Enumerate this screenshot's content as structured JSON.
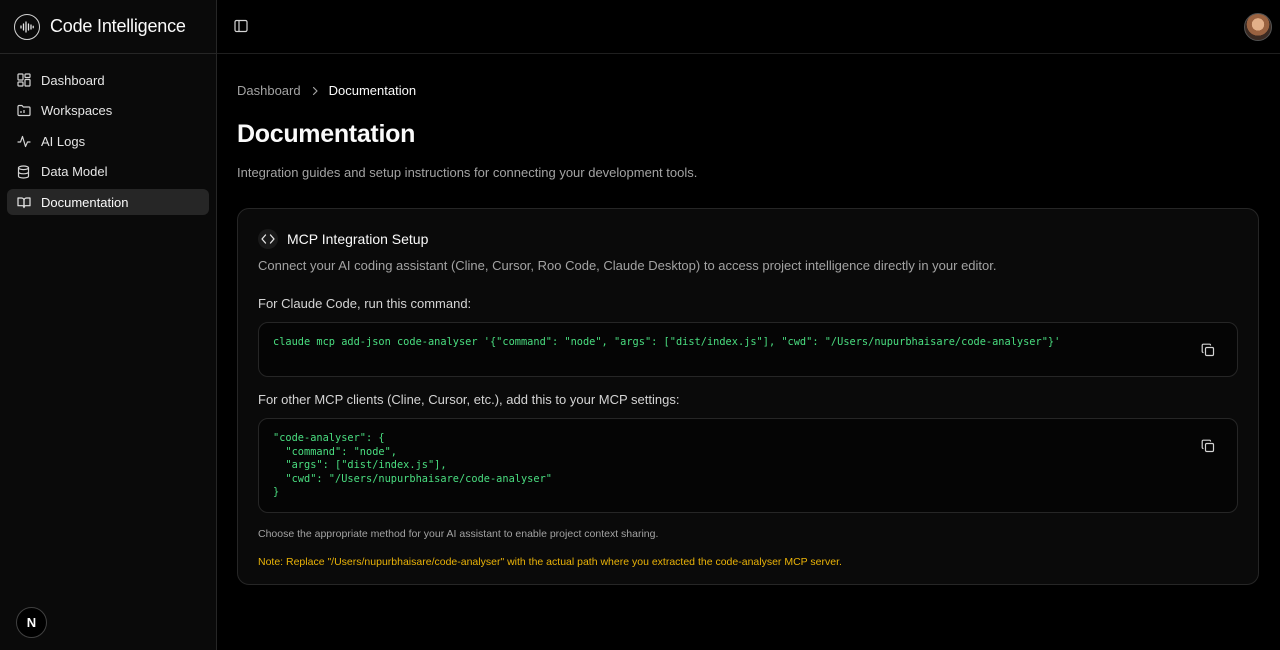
{
  "app": {
    "title": "Code Intelligence",
    "logo_icon": "waveform-logo-icon",
    "badge_letter": "N"
  },
  "sidebar": {
    "items": [
      {
        "label": "Dashboard",
        "icon": "dashboard-grid-icon",
        "active": false
      },
      {
        "label": "Workspaces",
        "icon": "folder-icon",
        "active": false
      },
      {
        "label": "AI Logs",
        "icon": "activity-icon",
        "active": false
      },
      {
        "label": "Data Model",
        "icon": "database-icon",
        "active": false
      },
      {
        "label": "Documentation",
        "icon": "book-icon",
        "active": true
      }
    ]
  },
  "breadcrumb": {
    "items": [
      "Dashboard",
      "Documentation"
    ]
  },
  "page": {
    "title": "Documentation",
    "subtitle": "Integration guides and setup instructions for connecting your development tools."
  },
  "card": {
    "title": "MCP Integration Setup",
    "icon": "code-brackets-icon",
    "description": "Connect your AI coding assistant (Cline, Cursor, Roo Code, Claude Desktop) to access project intelligence directly in your editor.",
    "claude_label": "For Claude Code, run this command:",
    "claude_code": "claude mcp add-json code-analyser '{\"command\": \"node\", \"args\": [\"dist/index.js\"], \"cwd\": \"/Users/nupurbhaisare/code-analyser\"}'",
    "other_label": "For other MCP clients (Cline, Cursor, etc.), add this to your MCP settings:",
    "other_code": "\"code-analyser\": {\n  \"command\": \"node\",\n  \"args\": [\"dist/index.js\"],\n  \"cwd\": \"/Users/nupurbhaisare/code-analyser\"\n}",
    "footer": "Choose the appropriate method for your AI assistant to enable project context sharing.",
    "note": "Note: Replace \"/Users/nupurbhaisare/code-analyser\" with the actual path where you extracted the code-analyser MCP server."
  },
  "colors": {
    "code_text": "#4ade80",
    "note_text": "#eab308",
    "active_nav_bg": "#262626"
  }
}
